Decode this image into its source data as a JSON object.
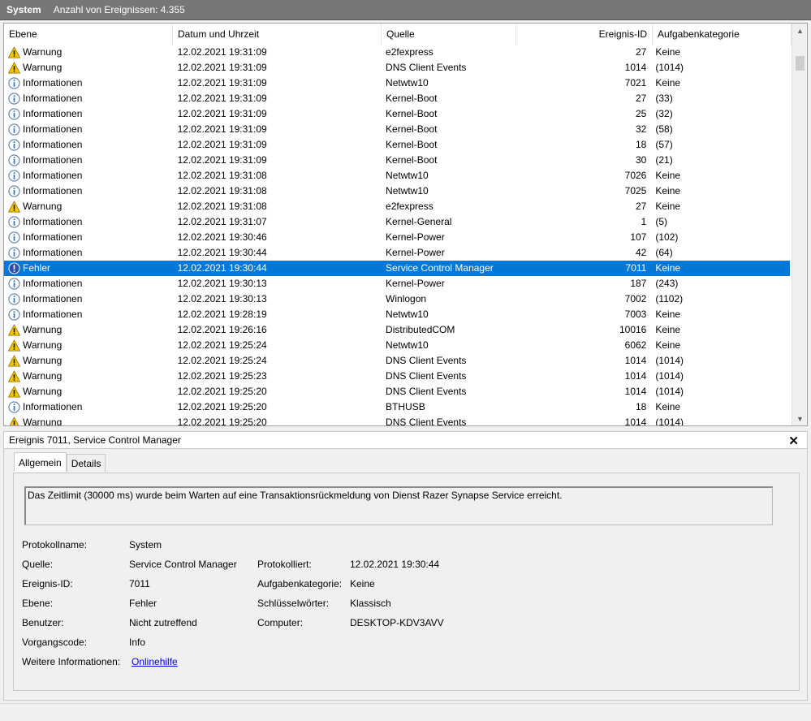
{
  "titlebar": {
    "log_name": "System",
    "event_count": "Anzahl von Ereignissen: 4.355"
  },
  "columns": {
    "level": "Ebene",
    "date": "Datum und Uhrzeit",
    "source": "Quelle",
    "event_id": "Ereignis-ID",
    "category": "Aufgabenkategorie"
  },
  "rows": [
    {
      "level": "Warnung",
      "icon": "warning-icon",
      "date": "12.02.2021 19:31:09",
      "source": "e2fexpress",
      "id": "27",
      "category": "Keine"
    },
    {
      "level": "Warnung",
      "icon": "warning-icon",
      "date": "12.02.2021 19:31:09",
      "source": "DNS Client Events",
      "id": "1014",
      "category": "(1014)"
    },
    {
      "level": "Informationen",
      "icon": "info-icon",
      "date": "12.02.2021 19:31:09",
      "source": "Netwtw10",
      "id": "7021",
      "category": "Keine"
    },
    {
      "level": "Informationen",
      "icon": "info-icon",
      "date": "12.02.2021 19:31:09",
      "source": "Kernel-Boot",
      "id": "27",
      "category": "(33)"
    },
    {
      "level": "Informationen",
      "icon": "info-icon",
      "date": "12.02.2021 19:31:09",
      "source": "Kernel-Boot",
      "id": "25",
      "category": "(32)"
    },
    {
      "level": "Informationen",
      "icon": "info-icon",
      "date": "12.02.2021 19:31:09",
      "source": "Kernel-Boot",
      "id": "32",
      "category": "(58)"
    },
    {
      "level": "Informationen",
      "icon": "info-icon",
      "date": "12.02.2021 19:31:09",
      "source": "Kernel-Boot",
      "id": "18",
      "category": "(57)"
    },
    {
      "level": "Informationen",
      "icon": "info-icon",
      "date": "12.02.2021 19:31:09",
      "source": "Kernel-Boot",
      "id": "30",
      "category": "(21)"
    },
    {
      "level": "Informationen",
      "icon": "info-icon",
      "date": "12.02.2021 19:31:08",
      "source": "Netwtw10",
      "id": "7026",
      "category": "Keine"
    },
    {
      "level": "Informationen",
      "icon": "info-icon",
      "date": "12.02.2021 19:31:08",
      "source": "Netwtw10",
      "id": "7025",
      "category": "Keine"
    },
    {
      "level": "Warnung",
      "icon": "warning-icon",
      "date": "12.02.2021 19:31:08",
      "source": "e2fexpress",
      "id": "27",
      "category": "Keine"
    },
    {
      "level": "Informationen",
      "icon": "info-icon",
      "date": "12.02.2021 19:31:07",
      "source": "Kernel-General",
      "id": "1",
      "category": "(5)"
    },
    {
      "level": "Informationen",
      "icon": "info-icon",
      "date": "12.02.2021 19:30:46",
      "source": "Kernel-Power",
      "id": "107",
      "category": "(102)"
    },
    {
      "level": "Informationen",
      "icon": "info-icon",
      "date": "12.02.2021 19:30:44",
      "source": "Kernel-Power",
      "id": "42",
      "category": "(64)"
    },
    {
      "level": "Fehler",
      "icon": "error-icon",
      "date": "12.02.2021 19:30:44",
      "source": "Service Control Manager",
      "id": "7011",
      "category": "Keine",
      "selected": true
    },
    {
      "level": "Informationen",
      "icon": "info-icon",
      "date": "12.02.2021 19:30:13",
      "source": "Kernel-Power",
      "id": "187",
      "category": "(243)"
    },
    {
      "level": "Informationen",
      "icon": "info-icon",
      "date": "12.02.2021 19:30:13",
      "source": "Winlogon",
      "id": "7002",
      "category": "(1102)"
    },
    {
      "level": "Informationen",
      "icon": "info-icon",
      "date": "12.02.2021 19:28:19",
      "source": "Netwtw10",
      "id": "7003",
      "category": "Keine"
    },
    {
      "level": "Warnung",
      "icon": "warning-icon",
      "date": "12.02.2021 19:26:16",
      "source": "DistributedCOM",
      "id": "10016",
      "category": "Keine"
    },
    {
      "level": "Warnung",
      "icon": "warning-icon",
      "date": "12.02.2021 19:25:24",
      "source": "Netwtw10",
      "id": "6062",
      "category": "Keine"
    },
    {
      "level": "Warnung",
      "icon": "warning-icon",
      "date": "12.02.2021 19:25:24",
      "source": "DNS Client Events",
      "id": "1014",
      "category": "(1014)"
    },
    {
      "level": "Warnung",
      "icon": "warning-icon",
      "date": "12.02.2021 19:25:23",
      "source": "DNS Client Events",
      "id": "1014",
      "category": "(1014)"
    },
    {
      "level": "Warnung",
      "icon": "warning-icon",
      "date": "12.02.2021 19:25:20",
      "source": "DNS Client Events",
      "id": "1014",
      "category": "(1014)"
    },
    {
      "level": "Informationen",
      "icon": "info-icon",
      "date": "12.02.2021 19:25:20",
      "source": "BTHUSB",
      "id": "18",
      "category": "Keine"
    },
    {
      "level": "Warnung",
      "icon": "warning-icon",
      "date": "12.02.2021 19:25:20",
      "source": "DNS Client Events",
      "id": "1014",
      "category": "(1014)"
    }
  ],
  "detail": {
    "title": "Ereignis 7011, Service Control Manager",
    "close_icon": "close-icon",
    "tabs": {
      "general": "Allgemein",
      "details": "Details"
    },
    "message": "Das Zeitlimit (30000 ms) wurde beim Warten auf eine Transaktionsrückmeldung von Dienst Razer Synapse Service erreicht.",
    "fields": {
      "log_name_label": "Protokollname:",
      "log_name_value": "System",
      "source_label": "Quelle:",
      "source_value": "Service Control Manager",
      "logged_label": "Protokolliert:",
      "logged_value": "12.02.2021 19:30:44",
      "event_id_label": "Ereignis-ID:",
      "event_id_value": "7011",
      "task_category_label": "Aufgabenkategorie:",
      "task_category_value": "Keine",
      "level_label": "Ebene:",
      "level_value": "Fehler",
      "keywords_label": "Schlüsselwörter:",
      "keywords_value": "Klassisch",
      "user_label": "Benutzer:",
      "user_value": "Nicht zutreffend",
      "computer_label": "Computer:",
      "computer_value": "DESKTOP-KDV3AVV",
      "opcode_label": "Vorgangscode:",
      "opcode_value": "Info",
      "more_info_label": "Weitere Informationen:",
      "more_info_link": "Onlinehilfe"
    }
  },
  "colors": {
    "selection": "#0078d7",
    "titlebar": "#777777",
    "warning": "#f5c400",
    "info": "#3a6ea5",
    "error": "#2f4fa8"
  }
}
